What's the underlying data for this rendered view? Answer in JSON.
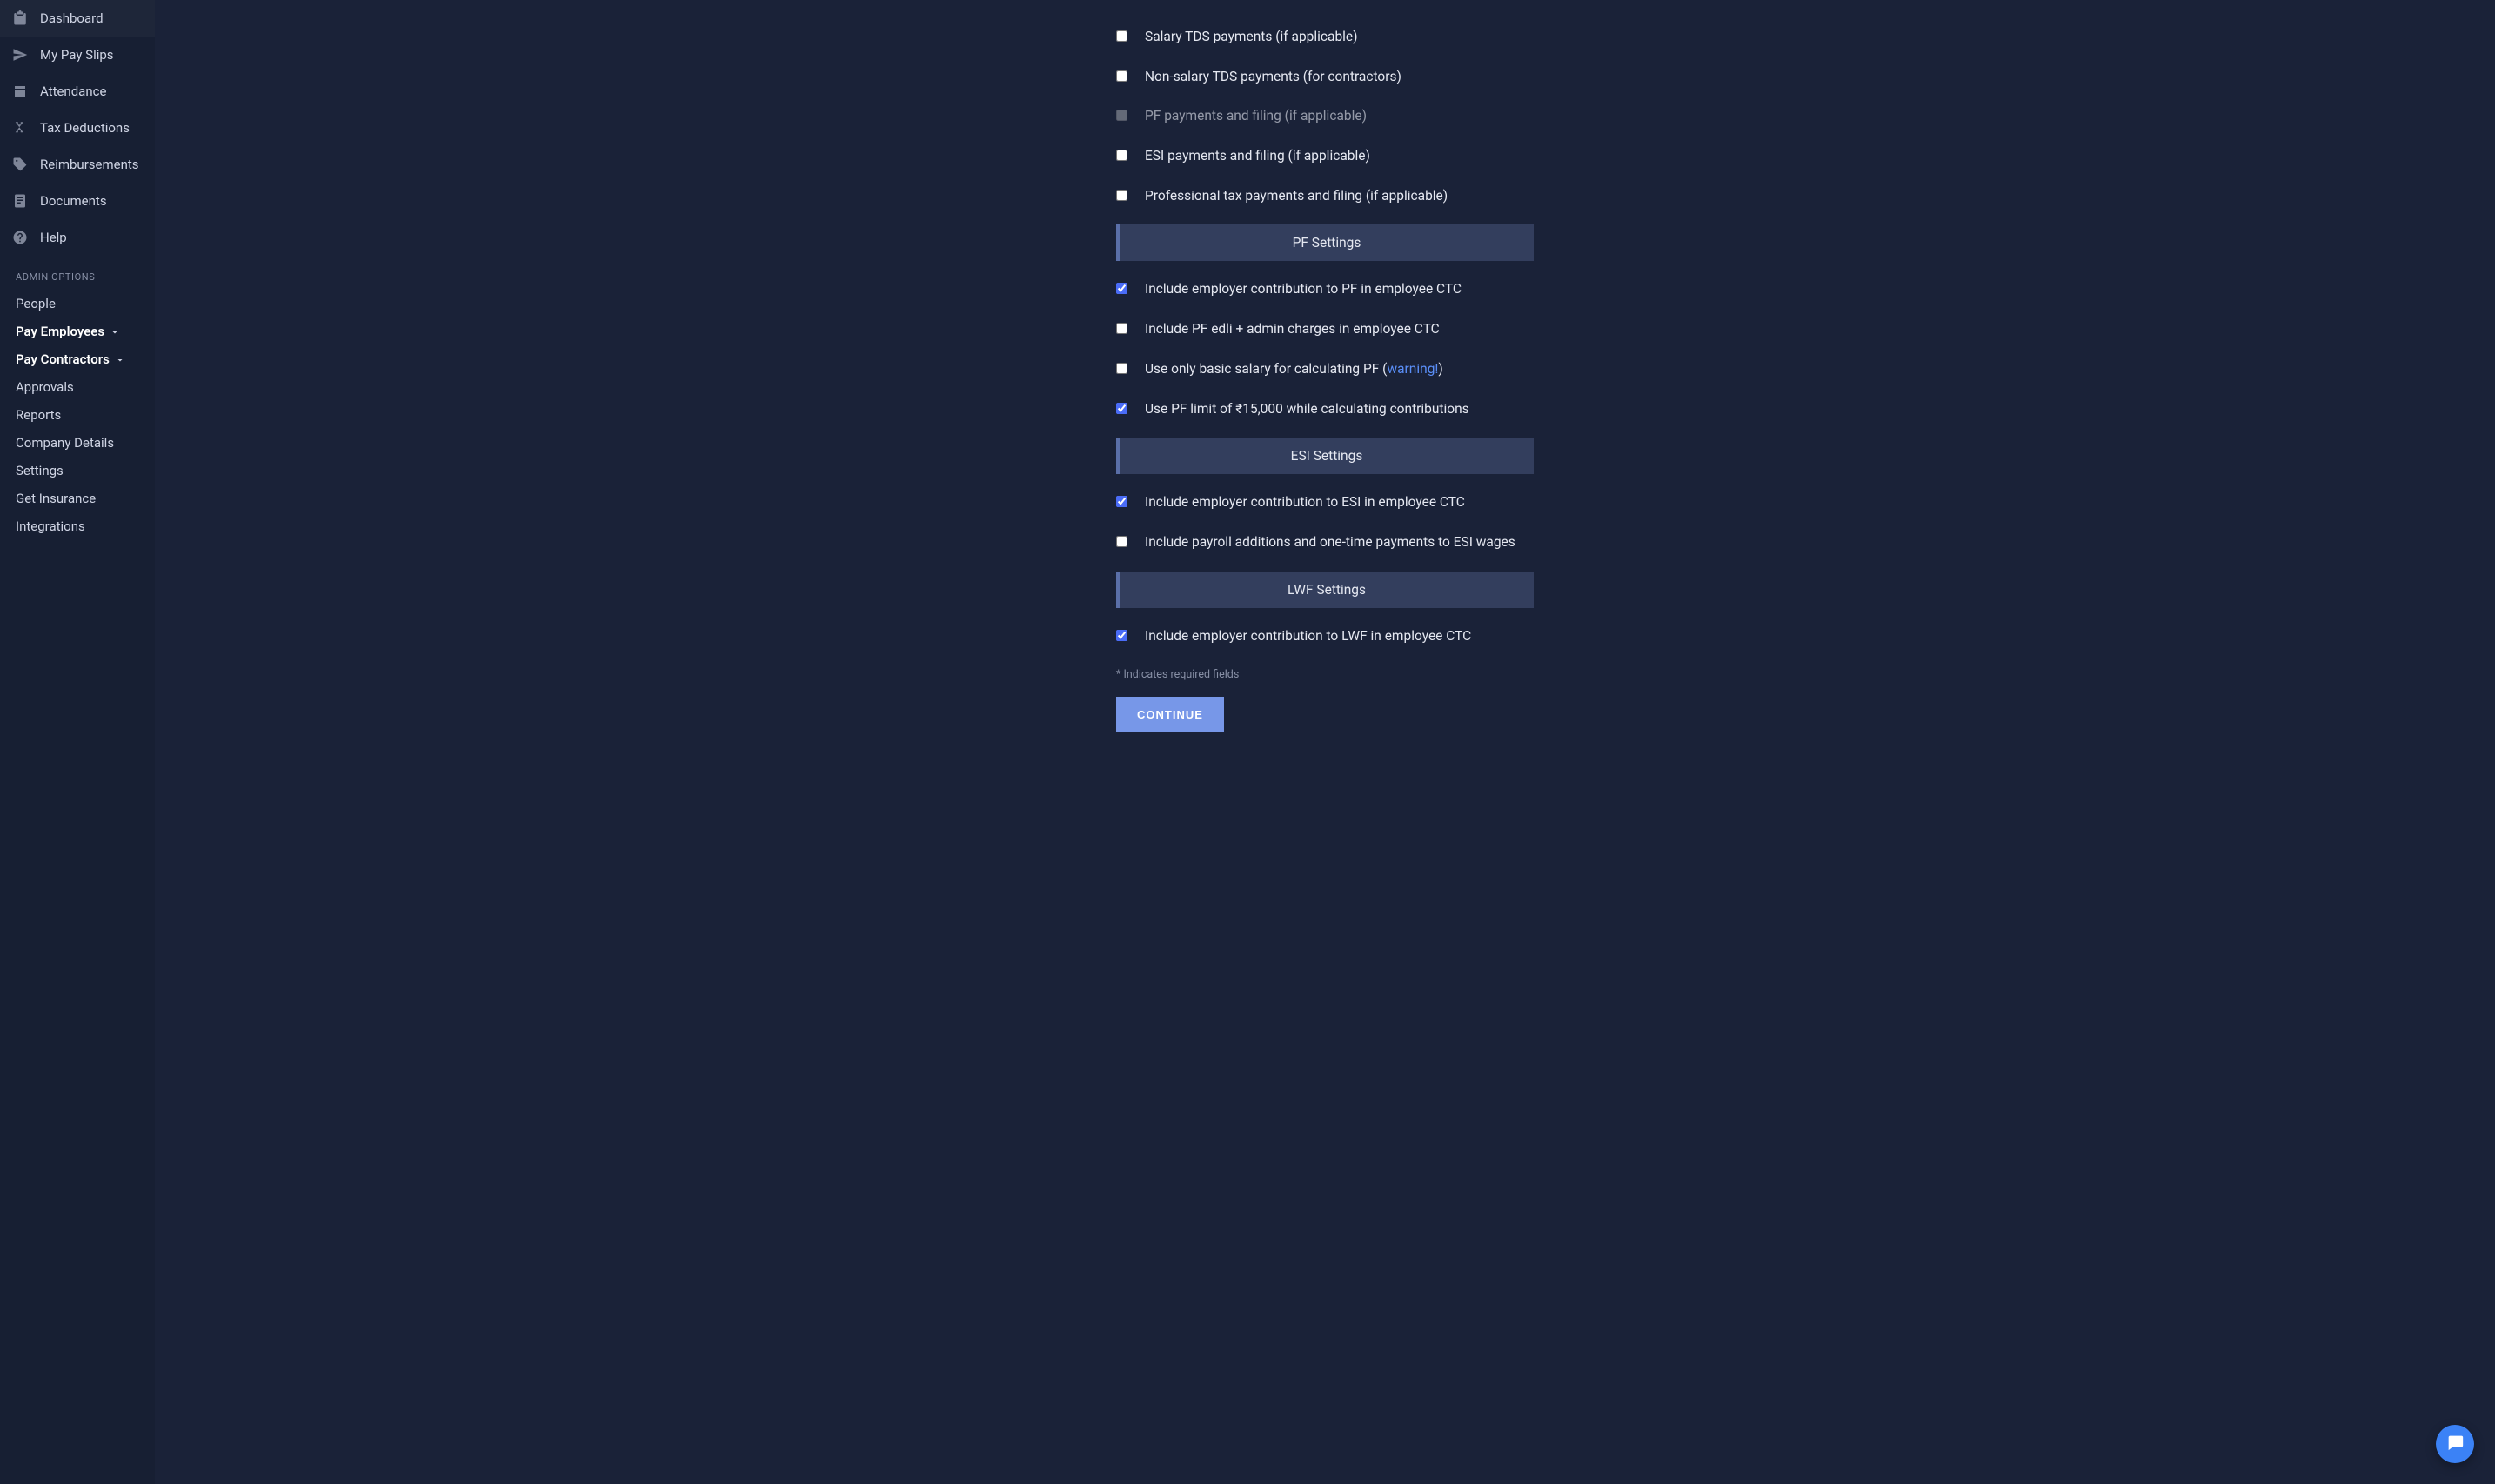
{
  "sidebar": {
    "nav": [
      {
        "key": "dashboard",
        "label": "Dashboard",
        "icon": "clipboard-icon"
      },
      {
        "key": "payslips",
        "label": "My Pay Slips",
        "icon": "paper-plane-icon"
      },
      {
        "key": "attendance",
        "label": "Attendance",
        "icon": "check-box-icon"
      },
      {
        "key": "taxdeductions",
        "label": "Tax Deductions",
        "icon": "plus-minus-icon"
      },
      {
        "key": "reimbursements",
        "label": "Reimbursements",
        "icon": "tag-icon"
      },
      {
        "key": "documents",
        "label": "Documents",
        "icon": "document-icon"
      },
      {
        "key": "help",
        "label": "Help",
        "icon": "question-icon"
      }
    ],
    "admin_section_title": "ADMIN OPTIONS",
    "admin": [
      {
        "key": "people",
        "label": "People",
        "expandable": false,
        "bold": false
      },
      {
        "key": "payemployees",
        "label": "Pay Employees",
        "expandable": true,
        "bold": true
      },
      {
        "key": "paycontractors",
        "label": "Pay Contractors",
        "expandable": true,
        "bold": true
      },
      {
        "key": "approvals",
        "label": "Approvals",
        "expandable": false,
        "bold": false
      },
      {
        "key": "reports",
        "label": "Reports",
        "expandable": false,
        "bold": false
      },
      {
        "key": "companydetails",
        "label": "Company Details",
        "expandable": false,
        "bold": false
      },
      {
        "key": "settings",
        "label": "Settings",
        "expandable": false,
        "bold": false
      },
      {
        "key": "getinsurance",
        "label": "Get Insurance",
        "expandable": false,
        "bold": false
      },
      {
        "key": "integrations",
        "label": "Integrations",
        "expandable": false,
        "bold": false
      }
    ]
  },
  "form": {
    "top_checks": [
      {
        "key": "salary_tds",
        "label": "Salary TDS payments (if applicable)",
        "checked": false,
        "disabled": false
      },
      {
        "key": "nonsalary_tds",
        "label": "Non-salary TDS payments (for contractors)",
        "checked": false,
        "disabled": false
      },
      {
        "key": "pf_payments",
        "label": "PF payments and filing (if applicable)",
        "checked": false,
        "disabled": true
      },
      {
        "key": "esi_payments",
        "label": "ESI payments and filing (if applicable)",
        "checked": false,
        "disabled": false
      },
      {
        "key": "pt_payments",
        "label": "Professional tax payments and filing (if applicable)",
        "checked": false,
        "disabled": false
      }
    ],
    "sections": [
      {
        "title": "PF Settings",
        "items": [
          {
            "key": "pf_ctc",
            "label": "Include employer contribution to PF in employee CTC",
            "checked": true
          },
          {
            "key": "pf_edli",
            "label": "Include PF edli + admin charges in employee CTC",
            "checked": false
          },
          {
            "key": "pf_basic_only",
            "label_pre": "Use only basic salary for calculating PF (",
            "warning": "warning!",
            "label_post": ")",
            "checked": false
          },
          {
            "key": "pf_limit",
            "label": "Use PF limit of ₹15,000 while calculating contributions",
            "checked": true
          }
        ]
      },
      {
        "title": "ESI Settings",
        "items": [
          {
            "key": "esi_ctc",
            "label": "Include employer contribution to ESI in employee CTC",
            "checked": true
          },
          {
            "key": "esi_additions",
            "label": "Include payroll additions and one-time payments to ESI wages",
            "checked": false
          }
        ]
      },
      {
        "title": "LWF Settings",
        "items": [
          {
            "key": "lwf_ctc",
            "label": "Include employer contribution to LWF in employee CTC",
            "checked": true
          }
        ]
      }
    ],
    "required_note": "* Indicates required fields",
    "continue_label": "CONTINUE"
  }
}
